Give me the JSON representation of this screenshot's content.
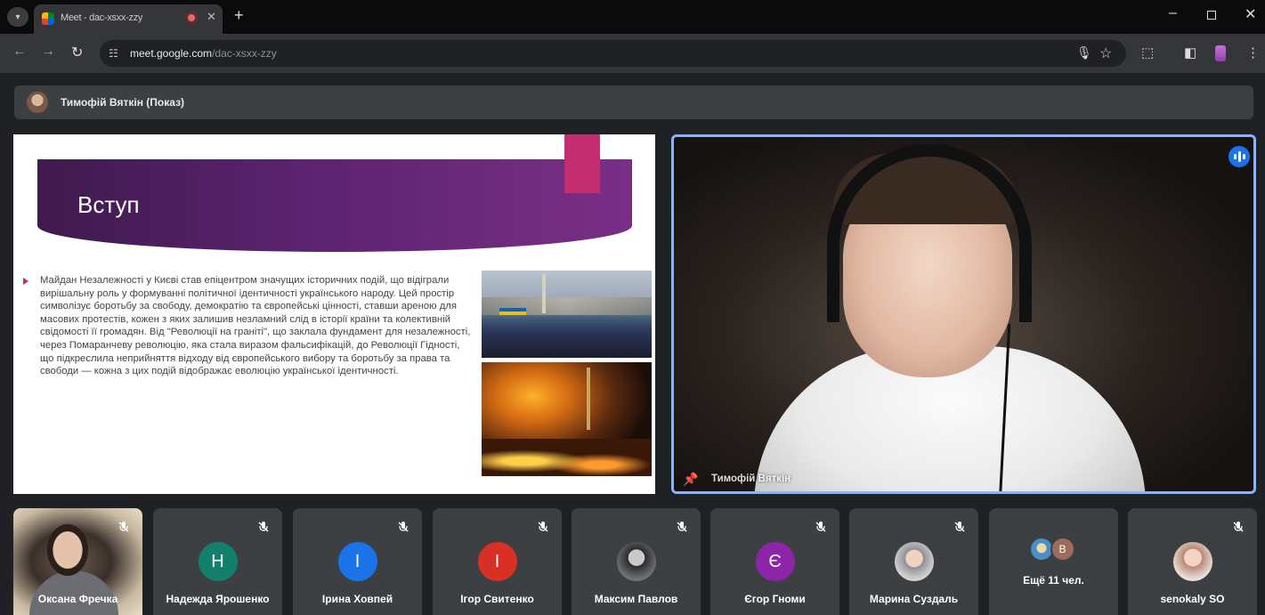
{
  "browser": {
    "tab_title": "Meet - dac-xsxx-zzy",
    "url_host": "meet.google.com",
    "url_path": "/dac-xsxx-zzy",
    "new_tab_label": "+",
    "close_tab_label": "✕"
  },
  "meet": {
    "presenter_label": "Тимофій Вяткін (Показ)",
    "slide": {
      "title": "Вступ",
      "body": "Майдан Незалежності у Києві став епіцентром значущих історичних подій, що відіграли вирішальну роль у формуванні політичної ідентичності українського народу. Цей простір символізує боротьбу за свободу, демократію та європейські цінності, ставши ареною для масових протестів, кожен з яких залишив незламний слід в історії країни та колективній свідомості її громадян. Від \"Революції на граніті\", що заклала фундамент для незалежності, через Помаранчеву революцію, яка стала виразом фальсифікацій, до Революції Гідності, що підкреслила неприйняття відходу від європейського вибору та боротьбу за права та свободи — кожна з цих подій відображає еволюцію української ідентичності."
    },
    "main_video": {
      "name": "Тимофій Вяткін"
    },
    "participants": [
      {
        "name": "Оксана Фречка",
        "type": "camera"
      },
      {
        "name": "Надежда Ярошенко",
        "initial": "Н",
        "color": "#12806a",
        "type": "initial"
      },
      {
        "name": "Ірина Ховпей",
        "initial": "І",
        "color": "#1a73e8",
        "type": "initial"
      },
      {
        "name": "Ігор Свитенко",
        "initial": "І",
        "color": "#d93025",
        "type": "initial"
      },
      {
        "name": "Максим Павлов",
        "type": "photo"
      },
      {
        "name": "Єгор Гноми",
        "initial": "Є",
        "color": "#8e24aa",
        "type": "initial"
      },
      {
        "name": "Марина Суздаль",
        "type": "photo"
      },
      {
        "name": "Ещё 11 чел.",
        "type": "more",
        "more_initial": "В"
      },
      {
        "name": "senokaly SO",
        "type": "photo"
      }
    ]
  }
}
